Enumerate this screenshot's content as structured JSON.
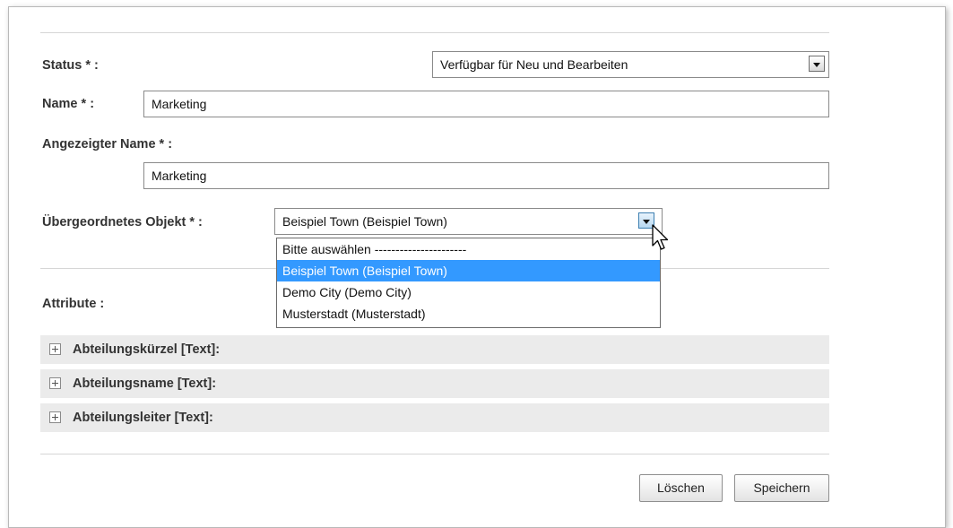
{
  "form": {
    "status": {
      "label": "Status * :",
      "value": "Verfügbar für Neu und Bearbeiten"
    },
    "name": {
      "label": "Name * :",
      "value": "Marketing"
    },
    "display_name": {
      "label": "Angezeigter Name * :",
      "value": "Marketing"
    },
    "parent": {
      "label": "Übergeordnetes Objekt * :",
      "value": "Beispiel Town (Beispiel Town)",
      "options": [
        "Bitte auswählen ----------------------",
        "Beispiel Town (Beispiel Town)",
        "Demo City (Demo City)",
        "Musterstadt (Musterstadt)"
      ],
      "selected_index": 1
    },
    "attributes": {
      "label": "Attribute :",
      "items": [
        "Abteilungskürzel [Text]:",
        "Abteilungsname [Text]:",
        "Abteilungsleiter [Text]:"
      ]
    }
  },
  "actions": {
    "delete_label": "Löschen",
    "save_label": "Speichern"
  },
  "icons": {
    "select_arrow": "chevron-down-icon",
    "expand": "plus-box-icon",
    "cursor": "mouse-pointer-icon"
  },
  "colors": {
    "highlight": "#3399ff",
    "attribute_row_bg": "#ebebeb"
  }
}
